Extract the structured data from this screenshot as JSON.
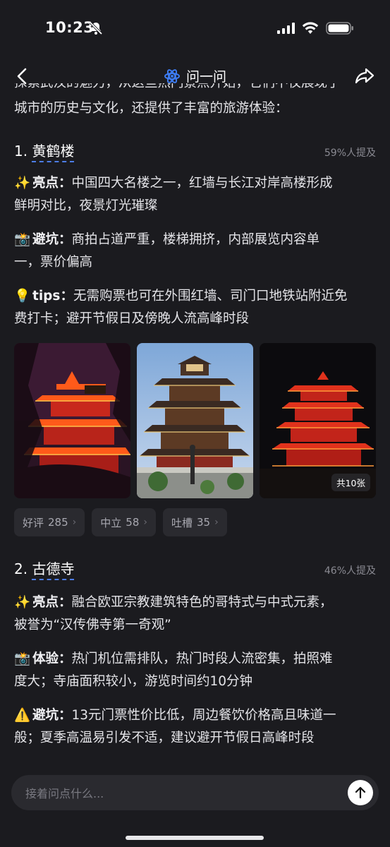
{
  "status": {
    "time": "10:23"
  },
  "nav": {
    "title": "问一问"
  },
  "content": {
    "cut_line": "探索武汉的魅力，从这些热门景点开始，它们不仅展现了",
    "intro_line": "城市的历史与文化，还提供了丰富的旅游体验：",
    "sections": [
      {
        "number": "1.",
        "name": "黄鹤楼",
        "mention": "59%人提及",
        "blocks": [
          {
            "emoji": "✨",
            "label": "亮点：",
            "text_line1": "中国四大名楼之一，红墙与长江对岸高楼形成",
            "text_line2": "鲜明对比，夜景灯光璀璨"
          },
          {
            "emoji": "📸",
            "label": "避坑：",
            "text_line1": "商拍占道严重，楼梯拥挤，内部展览内容单",
            "text_line2": "一，票价偏高"
          },
          {
            "emoji": "💡",
            "label": "tips：",
            "text_line1": "无需购票也可在外围红墙、司门口地铁站附近免",
            "text_line2": "费打卡；避开节假日及傍晚人流高峰时段"
          }
        ],
        "image_count": "共10张",
        "chips": [
          {
            "label": "好评",
            "count": "285"
          },
          {
            "label": "中立",
            "count": "58"
          },
          {
            "label": "吐槽",
            "count": "35"
          }
        ]
      },
      {
        "number": "2.",
        "name": "古德寺",
        "mention": "46%人提及",
        "blocks": [
          {
            "emoji": "✨",
            "label": "亮点：",
            "text_line1": "融合欧亚宗教建筑特色的哥特式与中式元素，",
            "text_line2": "被誉为“汉传佛寺第一奇观”"
          },
          {
            "emoji": "📸",
            "label": "体验：",
            "text_line1": "热门机位需排队，热门时段人流密集，拍照难",
            "text_line2": "度大；寺庙面积较小，游览时间约10分钟"
          },
          {
            "emoji": "⚠️",
            "label": "避坑：",
            "text_line1": "13元门票性价比低，周边餐饮价格高且味道一",
            "text_line2": "般；夏季高温易引发不适，建议避开节假日高峰时段"
          }
        ]
      }
    ]
  },
  "input": {
    "placeholder": "接着问点什么..."
  },
  "colors": {
    "background": "#1b1b1f",
    "accent": "#4d7de8",
    "chip_bg": "#2a2a2f"
  },
  "icons": [
    "back-icon",
    "app-logo-icon",
    "share-icon",
    "send-icon",
    "bell-slash-icon",
    "signal-icon",
    "wifi-icon",
    "battery-icon"
  ]
}
